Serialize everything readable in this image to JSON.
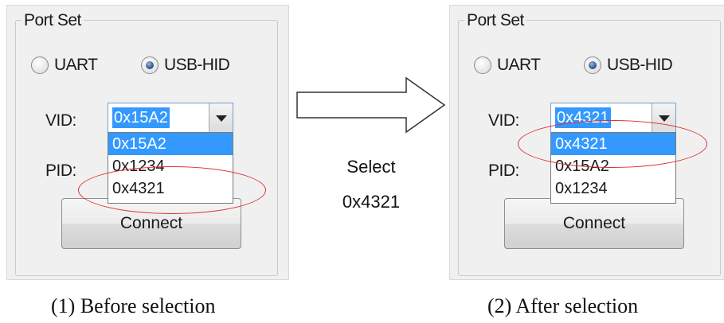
{
  "before": {
    "group_title": "Port Set",
    "radio_uart": "UART",
    "radio_hid": "USB-HID",
    "vid_label": "VID:",
    "pid_label": "PID:",
    "vid_value": "0x15A2",
    "options": [
      "0x15A2",
      "0x1234",
      "0x4321"
    ],
    "connect": "Connect",
    "caption": "(1) Before selection"
  },
  "after": {
    "group_title": "Port Set",
    "radio_uart": "UART",
    "radio_hid": "USB-HID",
    "vid_label": "VID:",
    "pid_label": "PID:",
    "vid_value": "0x4321",
    "options": [
      "0x4321",
      "0x15A2",
      "0x1234"
    ],
    "connect": "Connect",
    "caption": "(2) After selection"
  },
  "transition": {
    "line1": "Select",
    "line2": "0x4321"
  },
  "colors": {
    "selection": "#3399ff",
    "annotation": "#e03030",
    "panel_bg": "#f0f0f0"
  }
}
